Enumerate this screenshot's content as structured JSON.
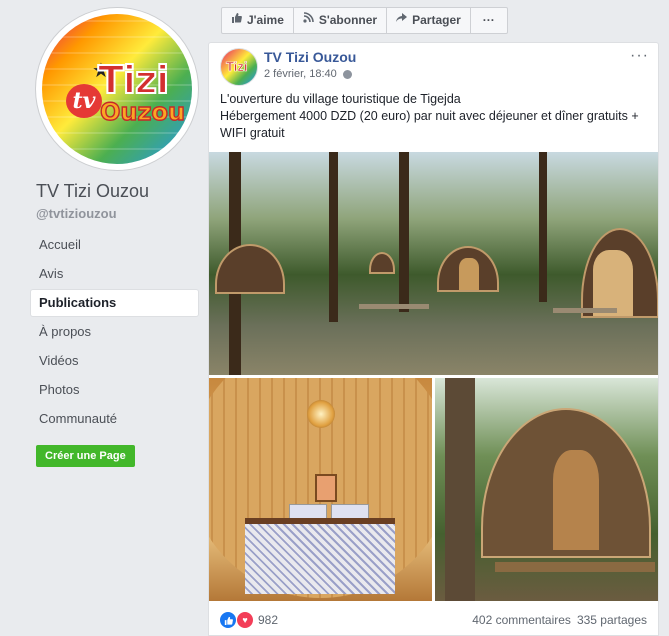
{
  "page": {
    "name": "TV Tizi Ouzou",
    "handle": "@tvtiziouzou",
    "logo": {
      "tv": "tv",
      "tizi": "Tizi",
      "ouzou": "Ouzou"
    }
  },
  "nav": {
    "items": [
      {
        "label": "Accueil",
        "active": false
      },
      {
        "label": "Avis",
        "active": false
      },
      {
        "label": "Publications",
        "active": true
      },
      {
        "label": "À propos",
        "active": false
      },
      {
        "label": "Vidéos",
        "active": false
      },
      {
        "label": "Photos",
        "active": false
      },
      {
        "label": "Communauté",
        "active": false
      }
    ],
    "create_page": "Créer une Page"
  },
  "actions": {
    "like": "J'aime",
    "subscribe": "S'abonner",
    "share": "Partager",
    "more": "···"
  },
  "post": {
    "author": "TV Tizi Ouzou",
    "date": "2 février, 18:40",
    "menu": "···",
    "text_line1": "L'ouverture du village touristique de Tigejda",
    "text_line2": "Hébergement 4000 DZD (20 euro) par nuit avec déjeuner et dîner gratuits + WIFI gratuit",
    "reactions_count": "982",
    "comments": "402 commentaires",
    "shares": "335 partages"
  },
  "colors": {
    "link": "#385898",
    "create_button": "#42b72a",
    "like_reaction": "#1877f2",
    "love_reaction": "#f33e58"
  },
  "icons": {
    "like": "thumbs-up-icon",
    "subscribe": "rss-icon",
    "share": "share-arrow-icon",
    "privacy": "globe-icon"
  }
}
